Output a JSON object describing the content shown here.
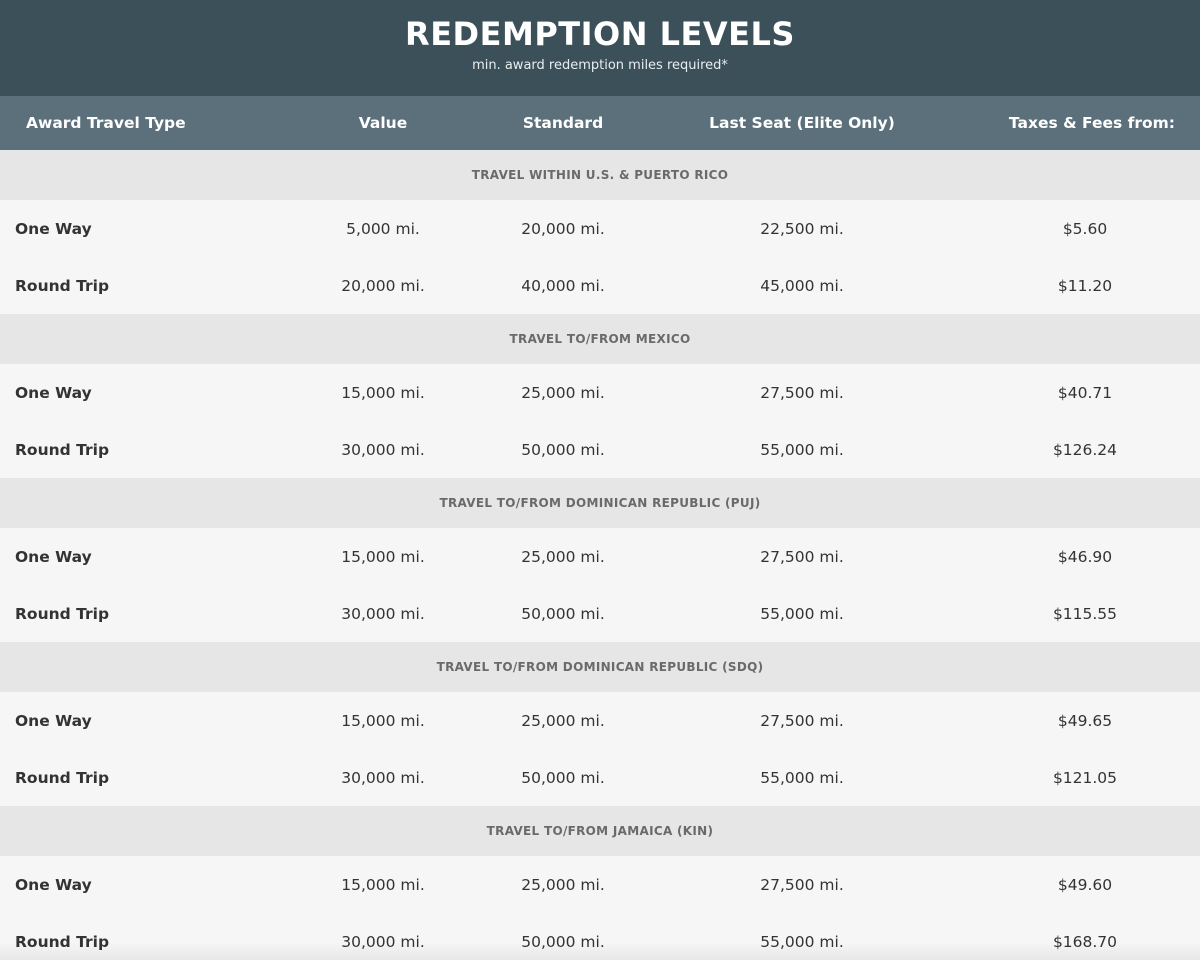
{
  "banner": {
    "title": "REDEMPTION LEVELS",
    "subtitle": "min. award redemption miles required*"
  },
  "colors": {
    "banner_bg": "#3c5059",
    "header_bg": "#5b707a",
    "section_bg": "#e6e6e6",
    "row_bg": "#f6f6f6",
    "text": "#333333"
  },
  "table": {
    "headers": {
      "type": "Award Travel Type",
      "value": "Value",
      "standard": "Standard",
      "last_seat": "Last Seat (Elite Only)",
      "taxes": "Taxes & Fees from:"
    },
    "sections": [
      {
        "title": "TRAVEL WITHIN U.S. & PUERTO RICO",
        "rows": [
          {
            "type": "One Way",
            "value": "5,000 mi.",
            "standard": "20,000 mi.",
            "last_seat": "22,500 mi.",
            "taxes": "$5.60"
          },
          {
            "type": "Round Trip",
            "value": "20,000 mi.",
            "standard": "40,000 mi.",
            "last_seat": "45,000 mi.",
            "taxes": "$11.20"
          }
        ]
      },
      {
        "title": "TRAVEL TO/FROM MEXICO",
        "rows": [
          {
            "type": "One Way",
            "value": "15,000 mi.",
            "standard": "25,000 mi.",
            "last_seat": "27,500 mi.",
            "taxes": "$40.71"
          },
          {
            "type": "Round Trip",
            "value": "30,000 mi.",
            "standard": "50,000 mi.",
            "last_seat": "55,000 mi.",
            "taxes": "$126.24"
          }
        ]
      },
      {
        "title": "TRAVEL TO/FROM DOMINICAN REPUBLIC (PUJ)",
        "rows": [
          {
            "type": "One Way",
            "value": "15,000 mi.",
            "standard": "25,000 mi.",
            "last_seat": "27,500 mi.",
            "taxes": "$46.90"
          },
          {
            "type": "Round Trip",
            "value": "30,000 mi.",
            "standard": "50,000 mi.",
            "last_seat": "55,000 mi.",
            "taxes": "$115.55"
          }
        ]
      },
      {
        "title": "TRAVEL TO/FROM DOMINICAN REPUBLIC (SDQ)",
        "rows": [
          {
            "type": "One Way",
            "value": "15,000 mi.",
            "standard": "25,000 mi.",
            "last_seat": "27,500 mi.",
            "taxes": "$49.65"
          },
          {
            "type": "Round Trip",
            "value": "30,000 mi.",
            "standard": "50,000 mi.",
            "last_seat": "55,000 mi.",
            "taxes": "$121.05"
          }
        ]
      },
      {
        "title": "TRAVEL TO/FROM JAMAICA (KIN)",
        "rows": [
          {
            "type": "One Way",
            "value": "15,000 mi.",
            "standard": "25,000 mi.",
            "last_seat": "27,500 mi.",
            "taxes": "$49.60"
          },
          {
            "type": "Round Trip",
            "value": "30,000 mi.",
            "standard": "50,000 mi.",
            "last_seat": "55,000 mi.",
            "taxes": "$168.70"
          }
        ]
      }
    ]
  }
}
